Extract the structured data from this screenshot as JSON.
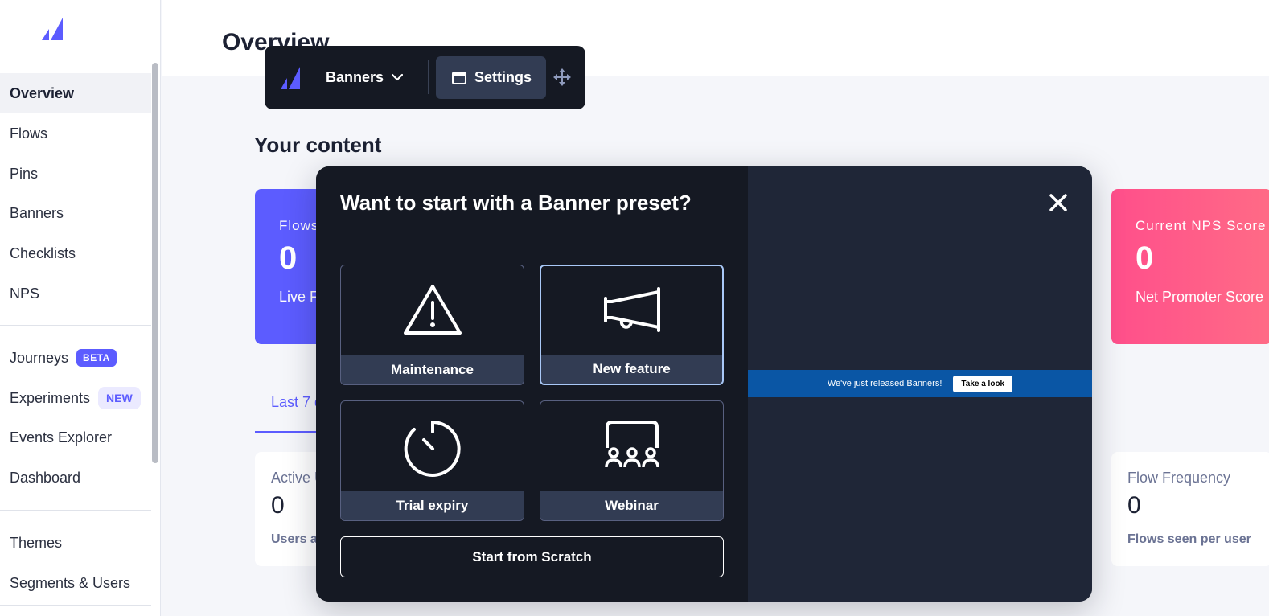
{
  "sidebar": {
    "logo_icon": "appcues-logo-icon",
    "items": [
      {
        "label": "Overview"
      },
      {
        "label": "Flows"
      },
      {
        "label": "Pins"
      },
      {
        "label": "Banners"
      },
      {
        "label": "Checklists"
      },
      {
        "label": "NPS"
      },
      {
        "label": "Journeys",
        "badge": "BETA"
      },
      {
        "label": "Experiments",
        "badge": "NEW"
      },
      {
        "label": "Events Explorer"
      },
      {
        "label": "Dashboard"
      },
      {
        "label": "Themes"
      },
      {
        "label": "Segments & Users"
      }
    ]
  },
  "page": {
    "title": "Overview",
    "section_title": "Your content",
    "cards": {
      "flows": {
        "label": "Flows",
        "value": "0",
        "sub": "Live F"
      },
      "nps": {
        "label": "Current NPS Score",
        "value": "0",
        "sub": "Net Promoter Score"
      }
    },
    "range_tab": "Last 7 d",
    "metrics": {
      "active": {
        "label": "Active U",
        "value": "0",
        "sub": "Users ac"
      },
      "frequency": {
        "label": "Flow Frequency",
        "value": "0",
        "sub": "Flows seen per user"
      }
    }
  },
  "toolbar": {
    "dropdown_label": "Banners",
    "settings_label": "Settings",
    "move_icon": "move-arrows-icon"
  },
  "modal": {
    "title": "Want to start with a Banner preset?",
    "presets": [
      {
        "label": "Maintenance",
        "icon": "warning-triangle-icon"
      },
      {
        "label": "New feature",
        "icon": "megaphone-icon",
        "selected": true
      },
      {
        "label": "Trial expiry",
        "icon": "timer-icon"
      },
      {
        "label": "Webinar",
        "icon": "audience-icon"
      }
    ],
    "scratch_label": "Start from Scratch",
    "preview": {
      "text": "We've just released Banners!",
      "button": "Take a look"
    }
  },
  "colors": {
    "accent": "#5c5cff",
    "nps": "#ff4f8b",
    "modal_bg": "#151923",
    "preview_banner": "#0a56a5"
  }
}
